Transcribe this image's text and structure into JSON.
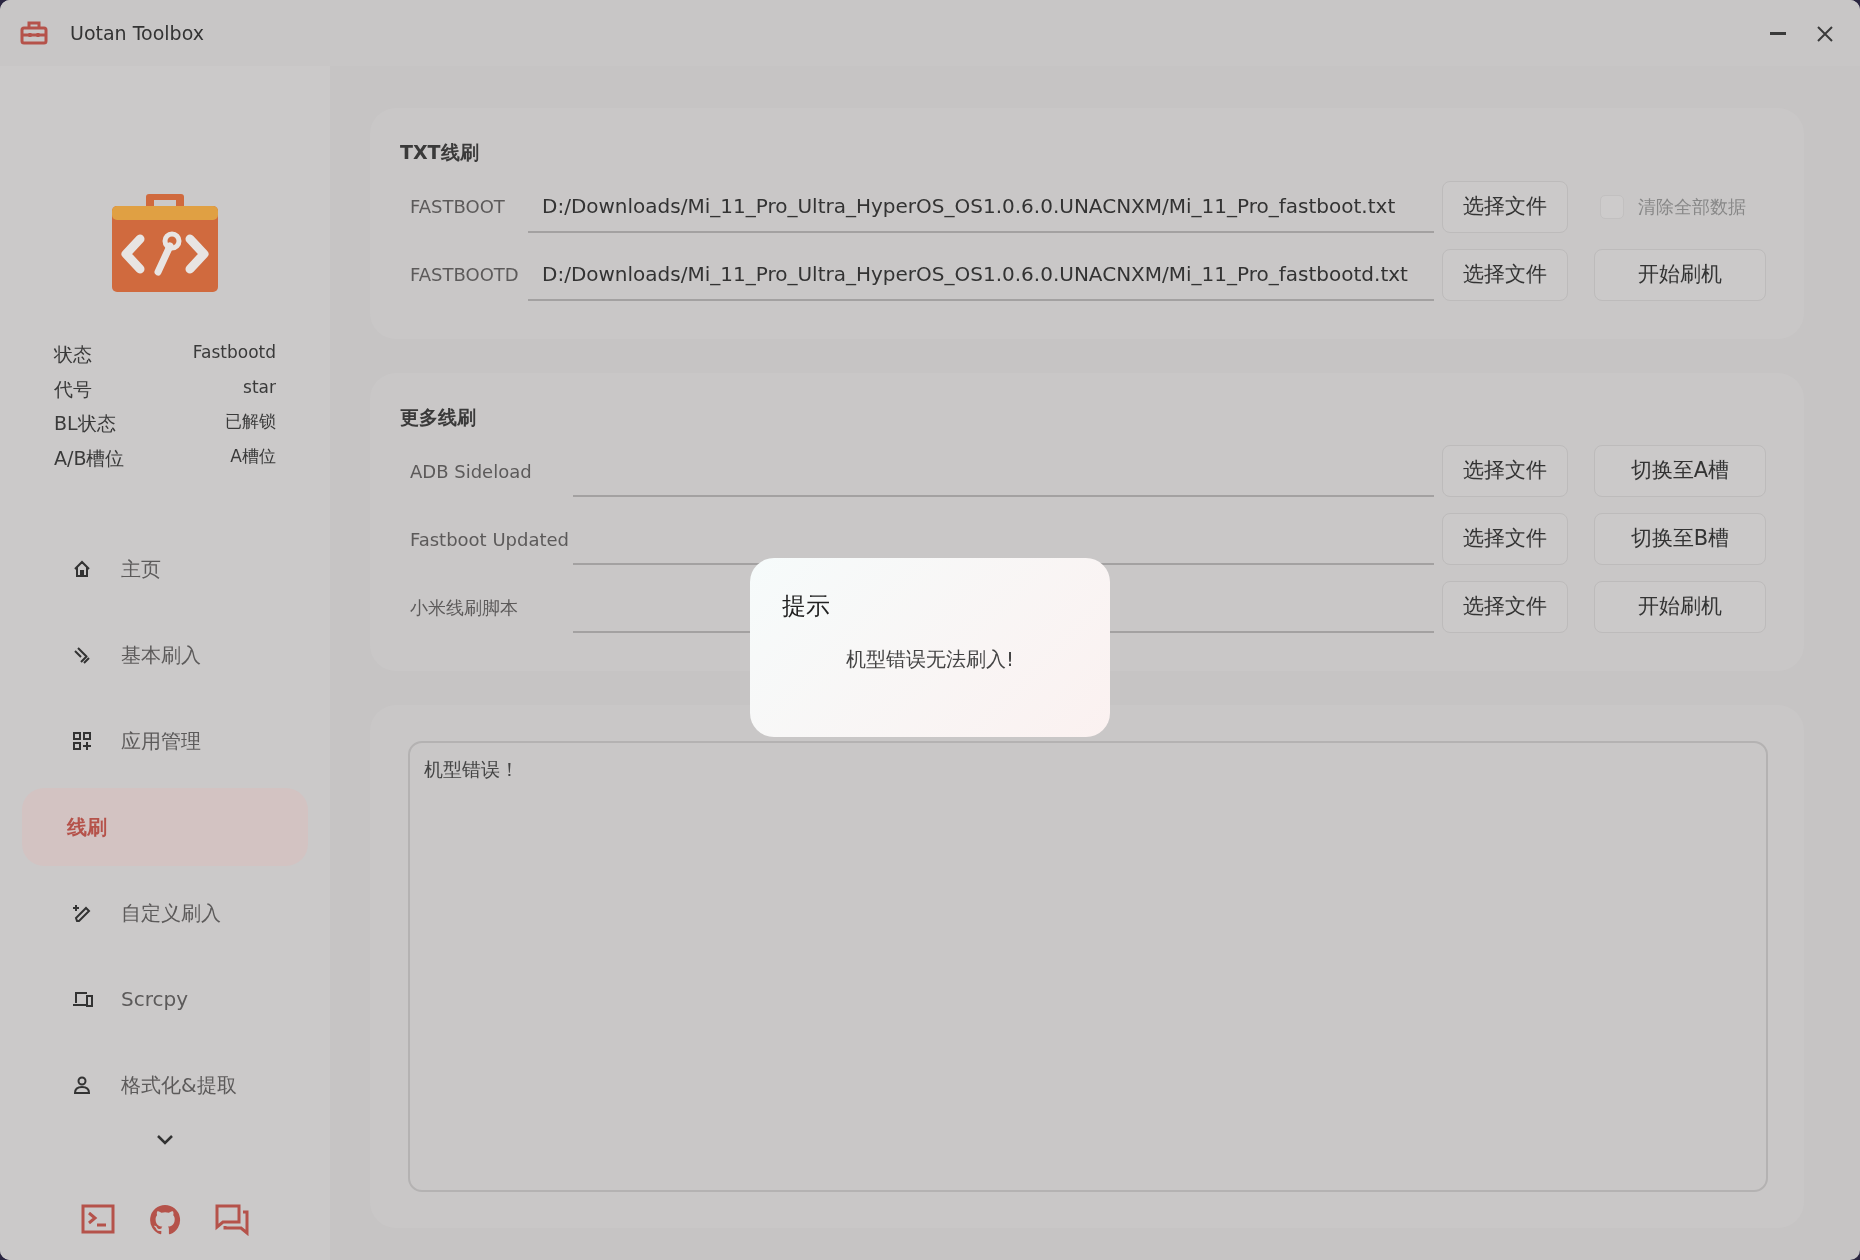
{
  "window": {
    "title": "Uotan Toolbox"
  },
  "sidebar": {
    "device_info": [
      {
        "label": "状态",
        "value": "Fastbootd"
      },
      {
        "label": "代号",
        "value": "star"
      },
      {
        "label": "BL状态",
        "value": "已解锁"
      },
      {
        "label": "A/B槽位",
        "value": "A槽位"
      }
    ],
    "nav": [
      {
        "label": "主页",
        "selected": false
      },
      {
        "label": "基本刷入",
        "selected": false
      },
      {
        "label": "应用管理",
        "selected": false
      },
      {
        "label": "线刷",
        "selected": true
      },
      {
        "label": "自定义刷入",
        "selected": false
      },
      {
        "label": "Scrcpy",
        "selected": false
      },
      {
        "label": "格式化&提取",
        "selected": false
      }
    ]
  },
  "txt_flash": {
    "title": "TXT线刷",
    "rows": [
      {
        "label": "FASTBOOT",
        "value": "D:/Downloads/Mi_11_Pro_Ultra_HyperOS_OS1.0.6.0.UNACNXM/Mi_11_Pro_fastboot.txt",
        "button": "选择文件"
      },
      {
        "label": "FASTBOOTD",
        "value": "D:/Downloads/Mi_11_Pro_Ultra_HyperOS_OS1.0.6.0.UNACNXM/Mi_11_Pro_fastbootd.txt",
        "button": "选择文件"
      }
    ],
    "wipe_checkbox": {
      "label": "清除全部数据",
      "checked": false
    },
    "flash_button": "开始刷机"
  },
  "more_flash": {
    "title": "更多线刷",
    "rows": [
      {
        "label": "ADB Sideload",
        "button": "选择文件",
        "action": "切换至A槽"
      },
      {
        "label": "Fastboot Updated",
        "button": "选择文件",
        "action": "切换至B槽"
      },
      {
        "label": "小米线刷脚本",
        "button": "选择文件",
        "action": "开始刷机"
      }
    ]
  },
  "log": {
    "text": "机型错误！"
  },
  "dialog": {
    "title": "提示",
    "message": "机型错误无法刷入!"
  }
}
